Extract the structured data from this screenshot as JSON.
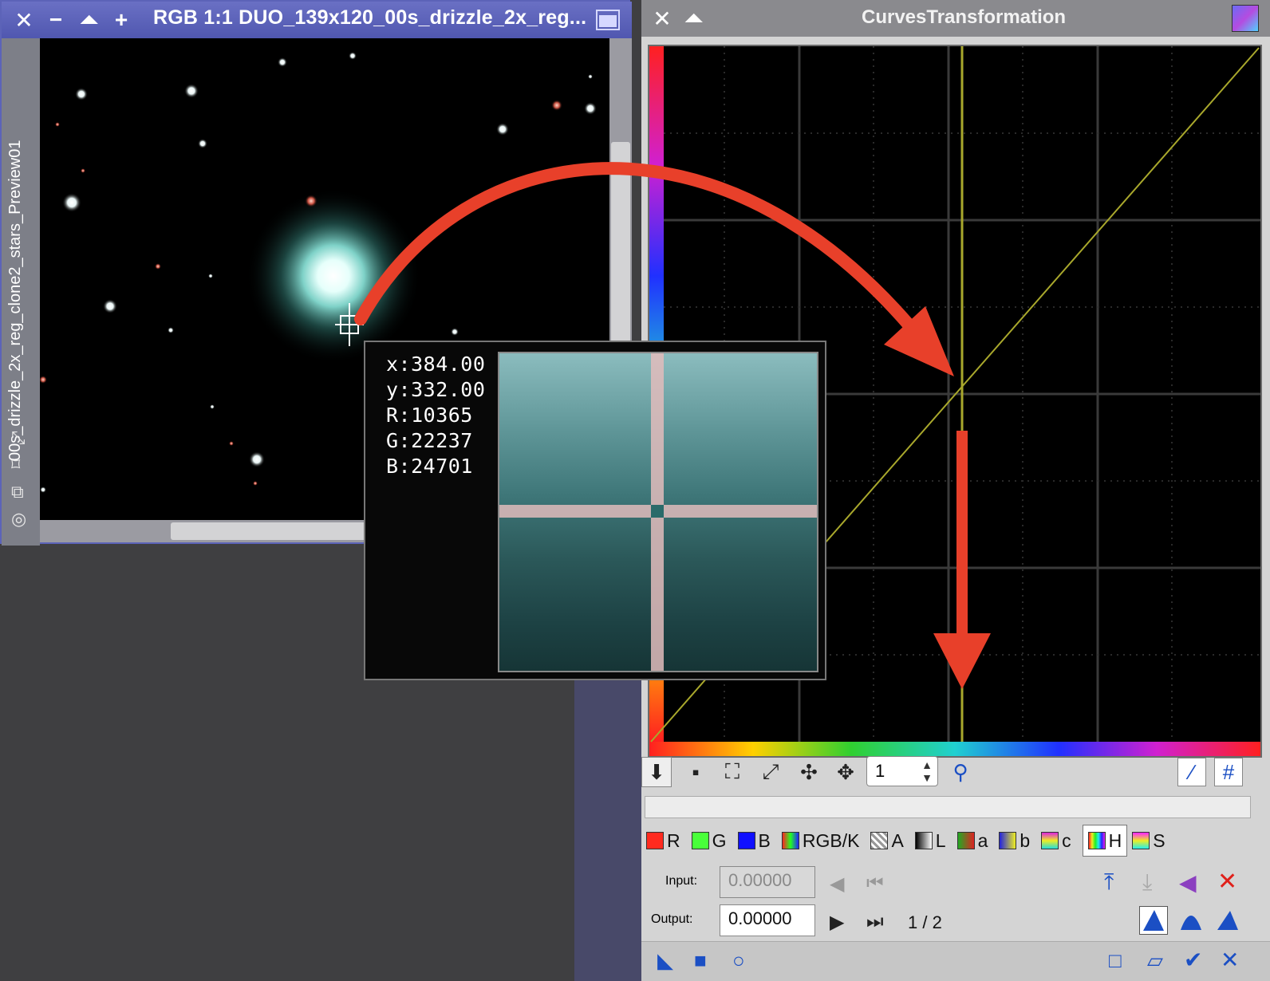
{
  "image_window": {
    "title": "RGB 1:1 DUO_139x120_00s_drizzle_2x_reg...",
    "side_label": "00s_drizzle_2x_reg_clone2_stars_Preview01",
    "titlebar_buttons": [
      "close",
      "minimize",
      "shade",
      "maximize"
    ]
  },
  "readout": {
    "x": "x:384.00",
    "y": "y:332.00",
    "r": "R:10365",
    "g": "G:22237",
    "b": "B:24701"
  },
  "curves": {
    "title": "CurvesTransformation",
    "zoom_value": "1",
    "channels": [
      {
        "label": "R",
        "color": "#ff2a1f"
      },
      {
        "label": "G",
        "color": "#49ff3a"
      },
      {
        "label": "B",
        "color": "#1010ff"
      },
      {
        "label": "RGB/K",
        "color": "#cc4444"
      },
      {
        "label": "A",
        "color": "#cccccc"
      },
      {
        "label": "L",
        "color": "#444444"
      },
      {
        "label": "a",
        "color": "#c03030"
      },
      {
        "label": "b",
        "color": "#3030c0"
      },
      {
        "label": "c",
        "color": "#aa44aa"
      },
      {
        "label": "H",
        "color": "#ff2222"
      },
      {
        "label": "S",
        "color": "#ff00ff"
      }
    ],
    "selected_channel": "H",
    "input_label": "Input:",
    "input_value": "0.00000",
    "output_label": "Output:",
    "output_value": "0.00000",
    "point_counter": "1 / 2"
  },
  "colors": {
    "accent_arrow": "#e8402a",
    "curve_line": "#a9a82c",
    "titlebar_active": "#5c63b8"
  }
}
